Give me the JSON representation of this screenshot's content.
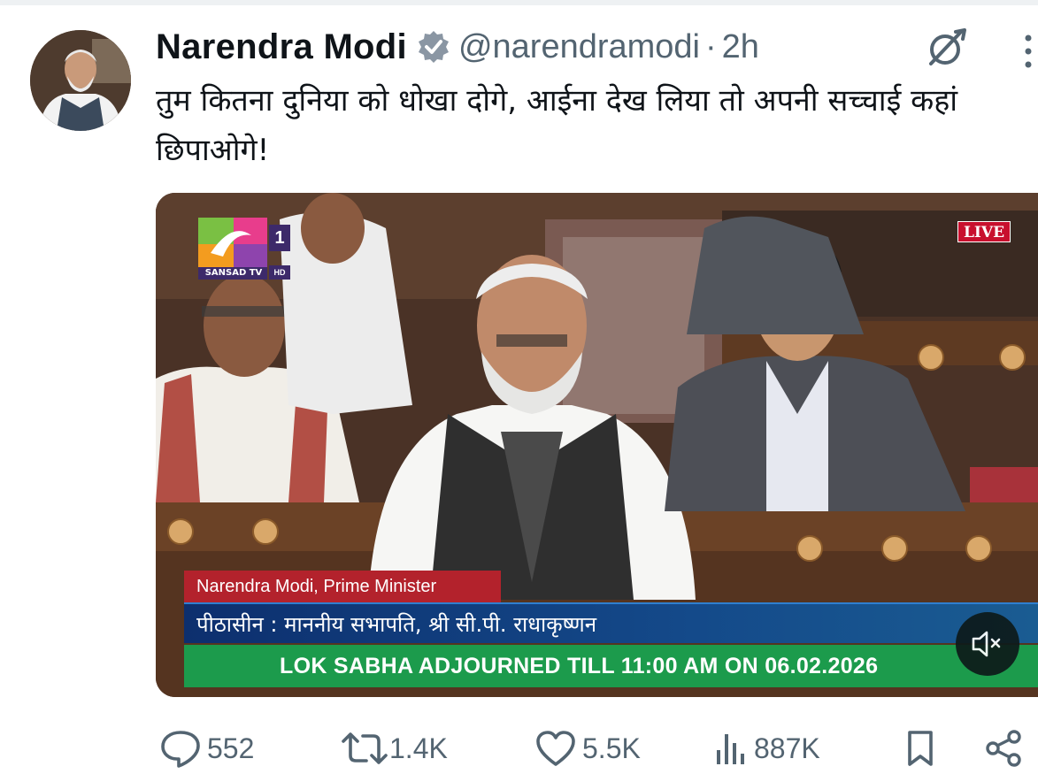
{
  "author": {
    "name": "Narendra Modi",
    "handle": "@narendramodi",
    "separator": "·",
    "time": "2h",
    "verified_icon": "verified-badge-icon"
  },
  "tweet": {
    "text": "तुम कितना दुनिया को धोखा दोगे, आईना देख लिया तो अपनी सच्चाई कहां छिपाओगे!"
  },
  "media": {
    "channel_number": "1",
    "channel_name": "SANSAD TV",
    "channel_hd": "HD",
    "live_label": "LIVE",
    "lower_third_name": "Narendra Modi, Prime Minister",
    "lower_third_chair": "पीठासीन : माननीय सभापति, श्री सी.पी. राधाकृष्णन",
    "ticker": "LOK SABHA ADJOURNED TILL 11:00 AM ON 06.02.2026",
    "mute_icon": "volume-muted-icon"
  },
  "actions": {
    "replies": "552",
    "reposts": "1.4K",
    "likes": "5.5K",
    "views": "887K"
  },
  "colors": {
    "text_primary": "#0f1419",
    "text_secondary": "#536471",
    "verified": "#8a96a3",
    "live_red": "#c8102e",
    "ticker_green": "#1c9b4c"
  }
}
